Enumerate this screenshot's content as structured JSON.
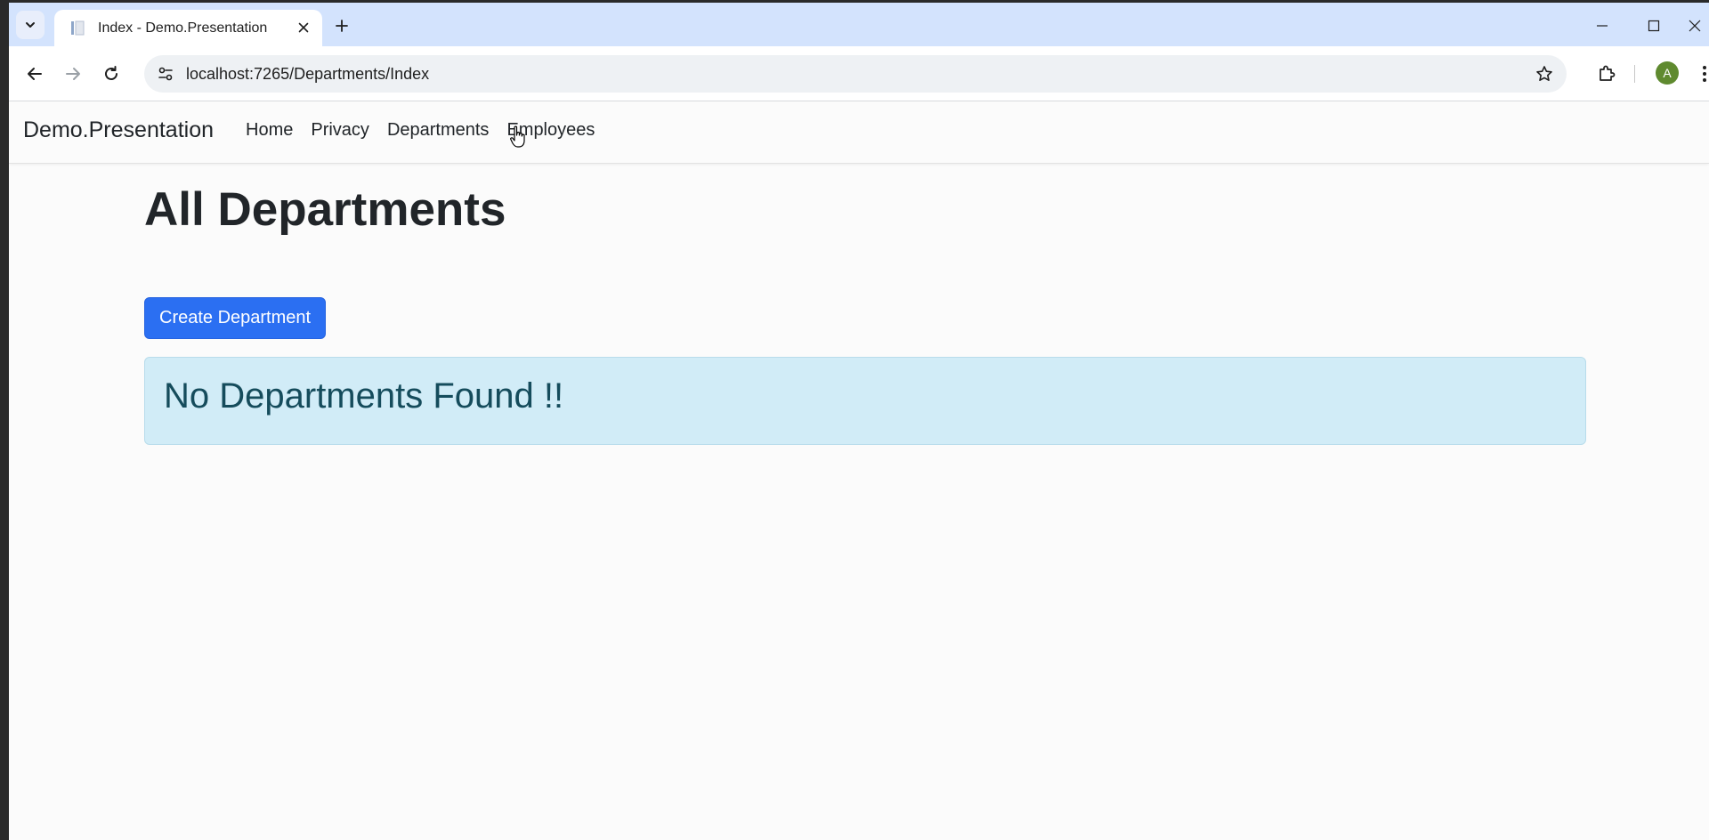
{
  "browser": {
    "tab": {
      "title": "Index - Demo.Presentation"
    },
    "omnibox": {
      "url": "localhost:7265/Departments/Index"
    },
    "profile": {
      "initial": "A",
      "color": "#5f8a2f"
    }
  },
  "site": {
    "brand": "Demo.Presentation",
    "nav": [
      {
        "label": "Home"
      },
      {
        "label": "Privacy"
      },
      {
        "label": "Departments"
      },
      {
        "label": "Employees"
      }
    ]
  },
  "main": {
    "title": "All Departments",
    "create_button": "Create Department",
    "empty_message": "No Departments Found !!"
  },
  "colors": {
    "primary": "#2b6ff2",
    "alert_bg": "#d1ecf7",
    "alert_text": "#154c5c",
    "tabstrip": "#d3e3fd"
  }
}
